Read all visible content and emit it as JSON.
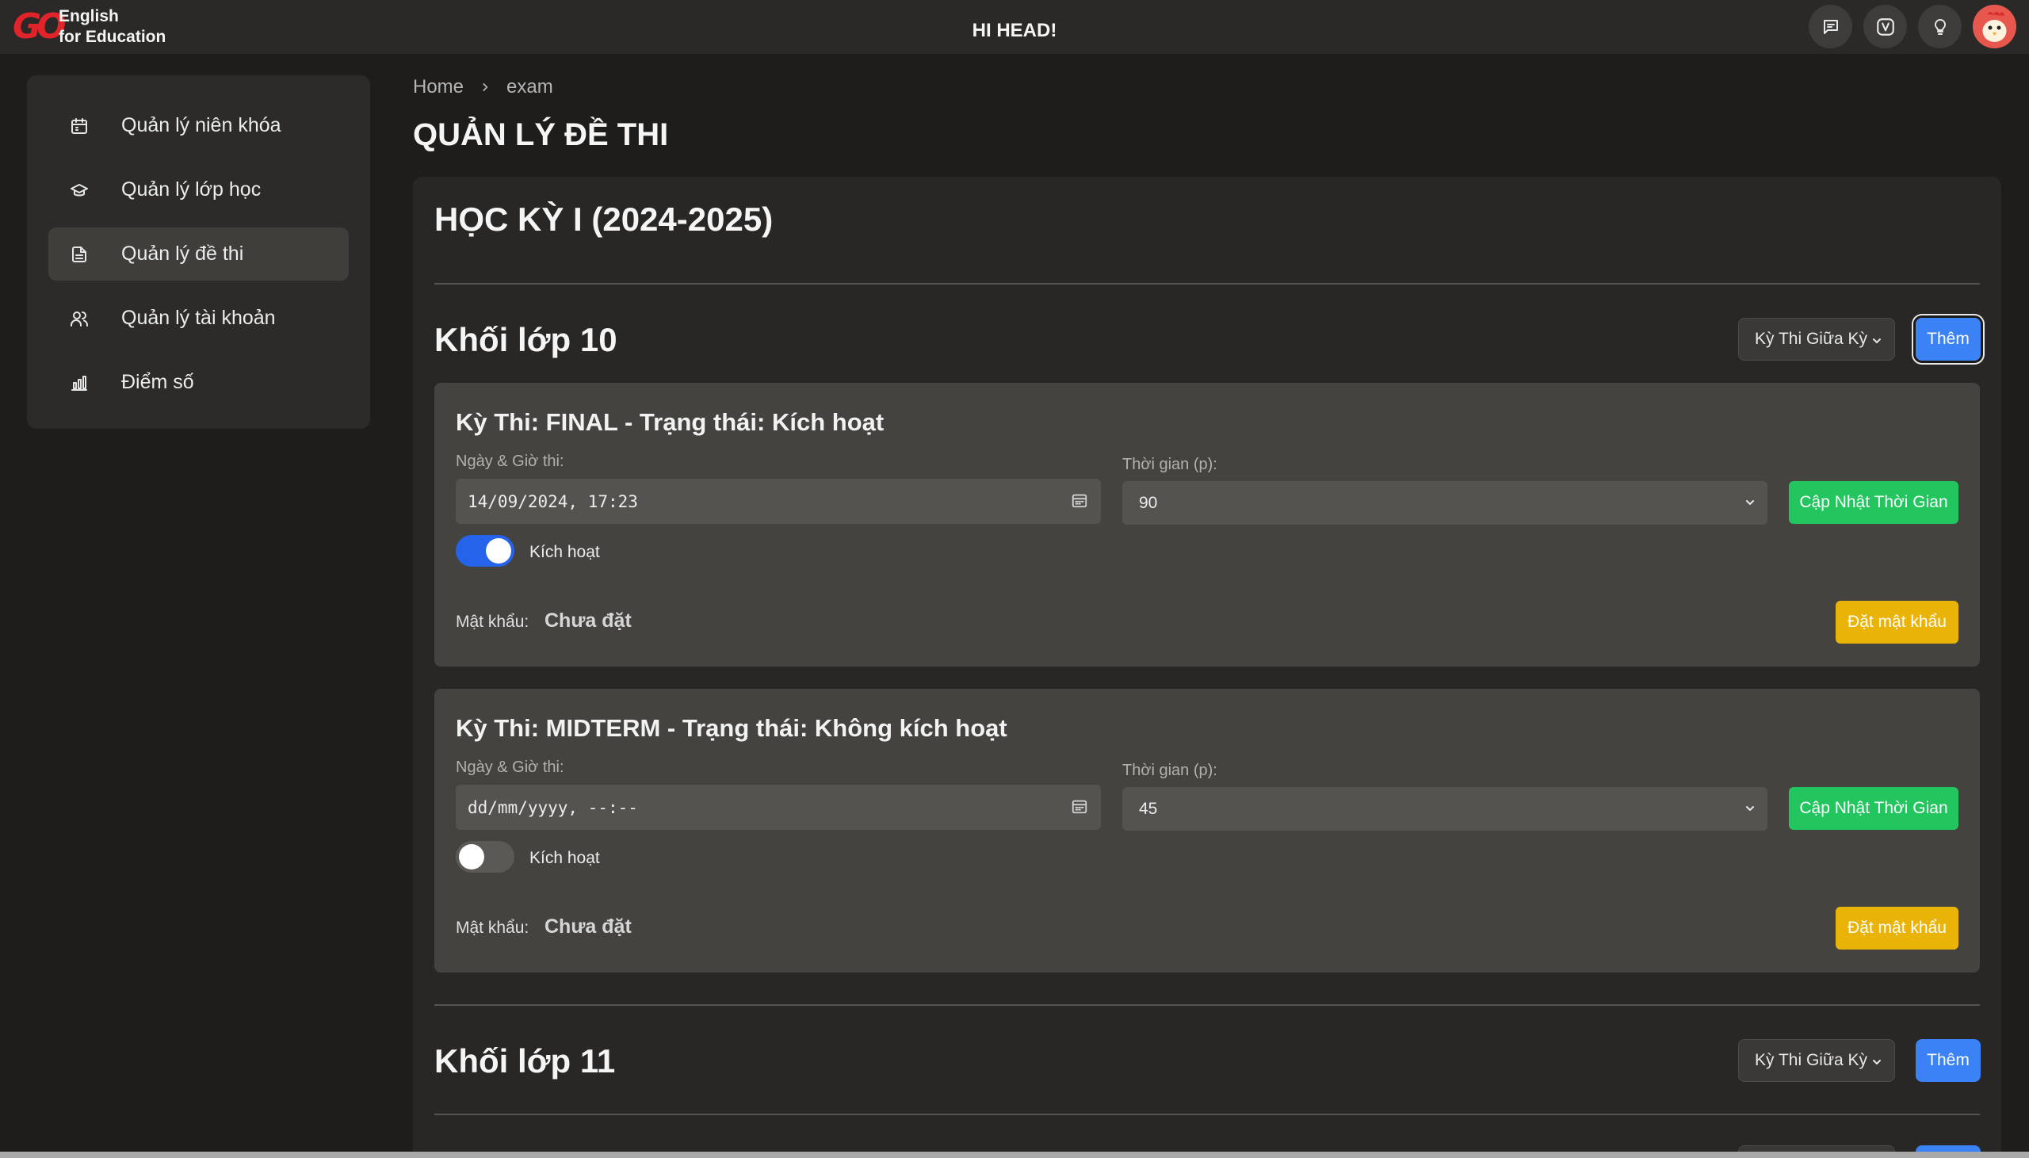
{
  "header": {
    "brand_mark": "GO",
    "brand_line1": "English",
    "brand_line2": "for Education",
    "greeting": "HI HEAD!",
    "icons": [
      "message-icon",
      "vocabulary-icon",
      "lightbulb-icon",
      "user-avatar"
    ]
  },
  "sidebar": {
    "items": [
      {
        "label": "Quản lý niên khóa",
        "icon": "calendar-icon",
        "active": false
      },
      {
        "label": "Quản lý lớp học",
        "icon": "graduation-cap-icon",
        "active": false
      },
      {
        "label": "Quản lý đề thi",
        "icon": "document-icon",
        "active": true
      },
      {
        "label": "Quản lý tài khoản",
        "icon": "users-icon",
        "active": false
      },
      {
        "label": "Điểm số",
        "icon": "bar-chart-icon",
        "active": false
      }
    ]
  },
  "breadcrumb": {
    "home": "Home",
    "current": "exam"
  },
  "page_title": "QUẢN LÝ ĐỀ THI",
  "term_title": "HỌC KỲ I (2024-2025)",
  "grades": [
    {
      "title": "Khối lớp 10",
      "exam_type_selected": "Kỳ Thi Giữa Kỳ",
      "add_label": "Thêm",
      "exams": [
        {
          "title": "Kỳ Thi: FINAL - Trạng thái: Kích hoạt",
          "date_label": "Ngày & Giờ thi:",
          "date_value": "14/09/2024, 17:23",
          "duration_label": "Thời gian (p):",
          "duration_value": "90",
          "update_label": "Cập Nhật Thời Gian",
          "toggle_label": "Kích hoạt",
          "active": true,
          "password_label": "Mật khẩu:",
          "password_value": "Chưa đặt",
          "set_password_label": "Đặt mật khẩu"
        },
        {
          "title": "Kỳ Thi: MIDTERM - Trạng thái: Không kích hoạt",
          "date_label": "Ngày & Giờ thi:",
          "date_value": "dd/mm/yyyy, --:--",
          "duration_label": "Thời gian (p):",
          "duration_value": "45",
          "update_label": "Cập Nhật Thời Gian",
          "toggle_label": "Kích hoạt",
          "active": false,
          "password_label": "Mật khẩu:",
          "password_value": "Chưa đặt",
          "set_password_label": "Đặt mật khẩu"
        }
      ]
    },
    {
      "title": "Khối lớp 11",
      "exam_type_selected": "Kỳ Thi Giữa Kỳ",
      "add_label": "Thêm",
      "exams": []
    }
  ],
  "colors": {
    "background": "#1e1d1c",
    "card": "#45433f",
    "primary": "#3b82f6",
    "success": "#22c55e",
    "warning": "#eab308",
    "brand": "#e0242a"
  }
}
